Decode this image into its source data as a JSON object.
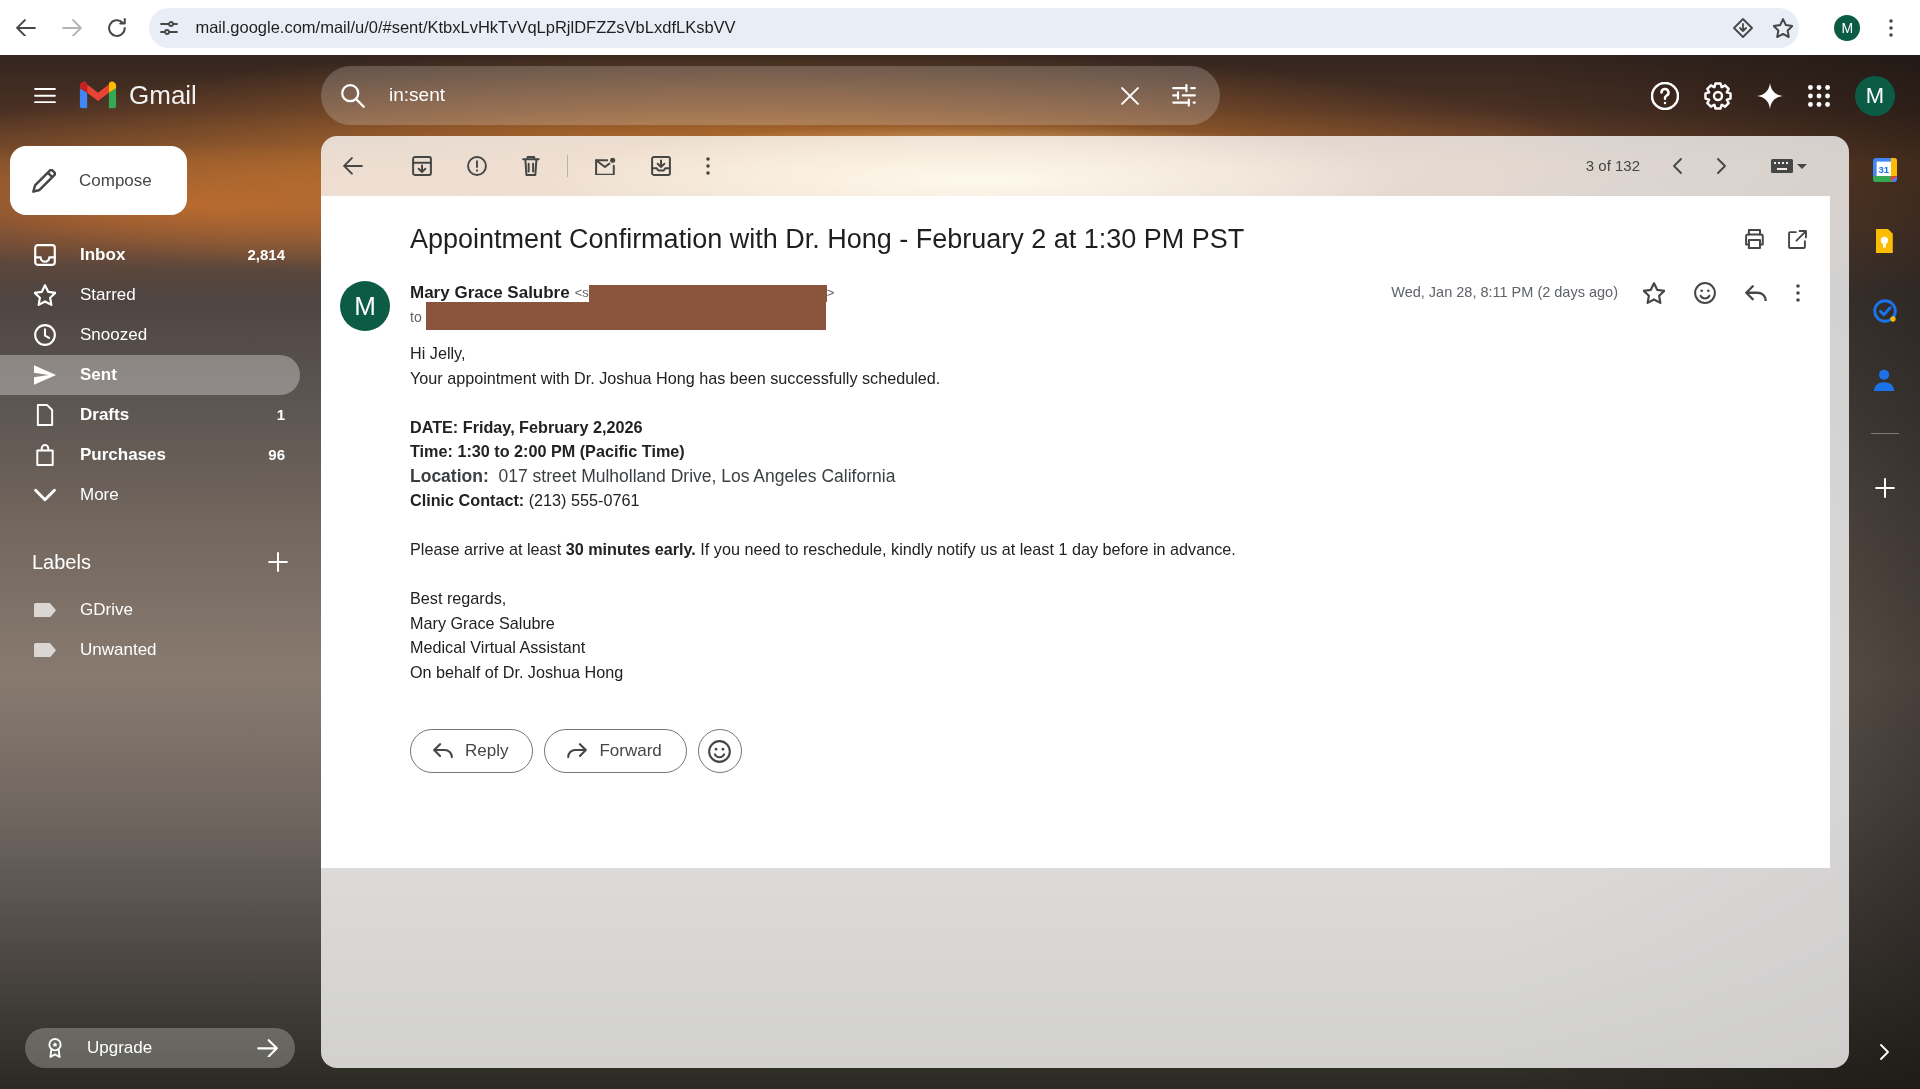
{
  "browser": {
    "url": "mail.google.com/mail/u/0/#sent/KtbxLvHkTvVqLpRjlDFZZsVbLxdfLKsbVV",
    "forward_disabled": true,
    "profile_initial": "M"
  },
  "header": {
    "app_name": "Gmail",
    "search": {
      "value": "in:sent"
    },
    "account_initial": "M"
  },
  "sidebar": {
    "compose": "Compose",
    "items": [
      {
        "label": "Inbox",
        "count": "2,814",
        "unread": true,
        "selected": false
      },
      {
        "label": "Starred",
        "unread": false,
        "selected": false
      },
      {
        "label": "Snoozed",
        "unread": false,
        "selected": false
      },
      {
        "label": "Sent",
        "unread": false,
        "selected": true
      },
      {
        "label": "Drafts",
        "count": "1",
        "unread": true,
        "selected": false
      },
      {
        "label": "Purchases",
        "count": "96",
        "unread": true,
        "selected": false
      },
      {
        "label": "More",
        "unread": false,
        "selected": false
      }
    ],
    "labels_heading": "Labels",
    "labels": [
      {
        "label": "GDrive"
      },
      {
        "label": "Unwanted"
      }
    ],
    "upgrade": "Upgrade"
  },
  "toolbar": {
    "position": "3 of 132"
  },
  "message": {
    "subject": "Appointment Confirmation with Dr. Hong - February 2 at 1:30 PM PST",
    "sender": {
      "initial": "M",
      "name": "Mary Grace Salubre",
      "email_start": "<s",
      "email_end": ">",
      "recipients_label": "to",
      "redacted": true
    },
    "date": "Wed, Jan 28, 8:11 PM (2 days ago)",
    "body": [
      {
        "lines": [
          {
            "kind": "text",
            "text": "Hi Jelly,"
          },
          {
            "kind": "text",
            "text": "Your appointment with Dr. Joshua Hong has been successfully scheduled."
          }
        ]
      },
      {
        "lines": [
          {
            "kind": "bold",
            "text": "DATE: Friday, February 2,2026"
          },
          {
            "kind": "bold",
            "text": "Time: 1:30 to 2:00 PM (Pacific Time)"
          },
          {
            "kind": "large",
            "text": "**Location:**  017 street Mulholland Drive, Los Angeles California"
          },
          {
            "kind": "text",
            "text": "**Clinic Contact:** (213) 555-0761"
          }
        ]
      },
      {
        "lines": [
          {
            "kind": "text",
            "text": "Please arrive at least **30 minutes early.** If you need to reschedule, kindly notify us at least 1 day before in advance."
          }
        ]
      },
      {
        "lines": [
          {
            "kind": "text",
            "text": "Best regards,"
          },
          {
            "kind": "text",
            "text": "Mary Grace Salubre"
          },
          {
            "kind": "text",
            "text": "Medical Virtual Assistant"
          },
          {
            "kind": "text",
            "text": "On behalf of Dr. Joshua Hong"
          }
        ]
      }
    ],
    "actions": [
      {
        "kind": "reply",
        "label": "Reply"
      },
      {
        "kind": "forward",
        "label": "Forward"
      },
      {
        "kind": "react"
      }
    ]
  },
  "side_panel": {
    "calendar_day": "31"
  }
}
